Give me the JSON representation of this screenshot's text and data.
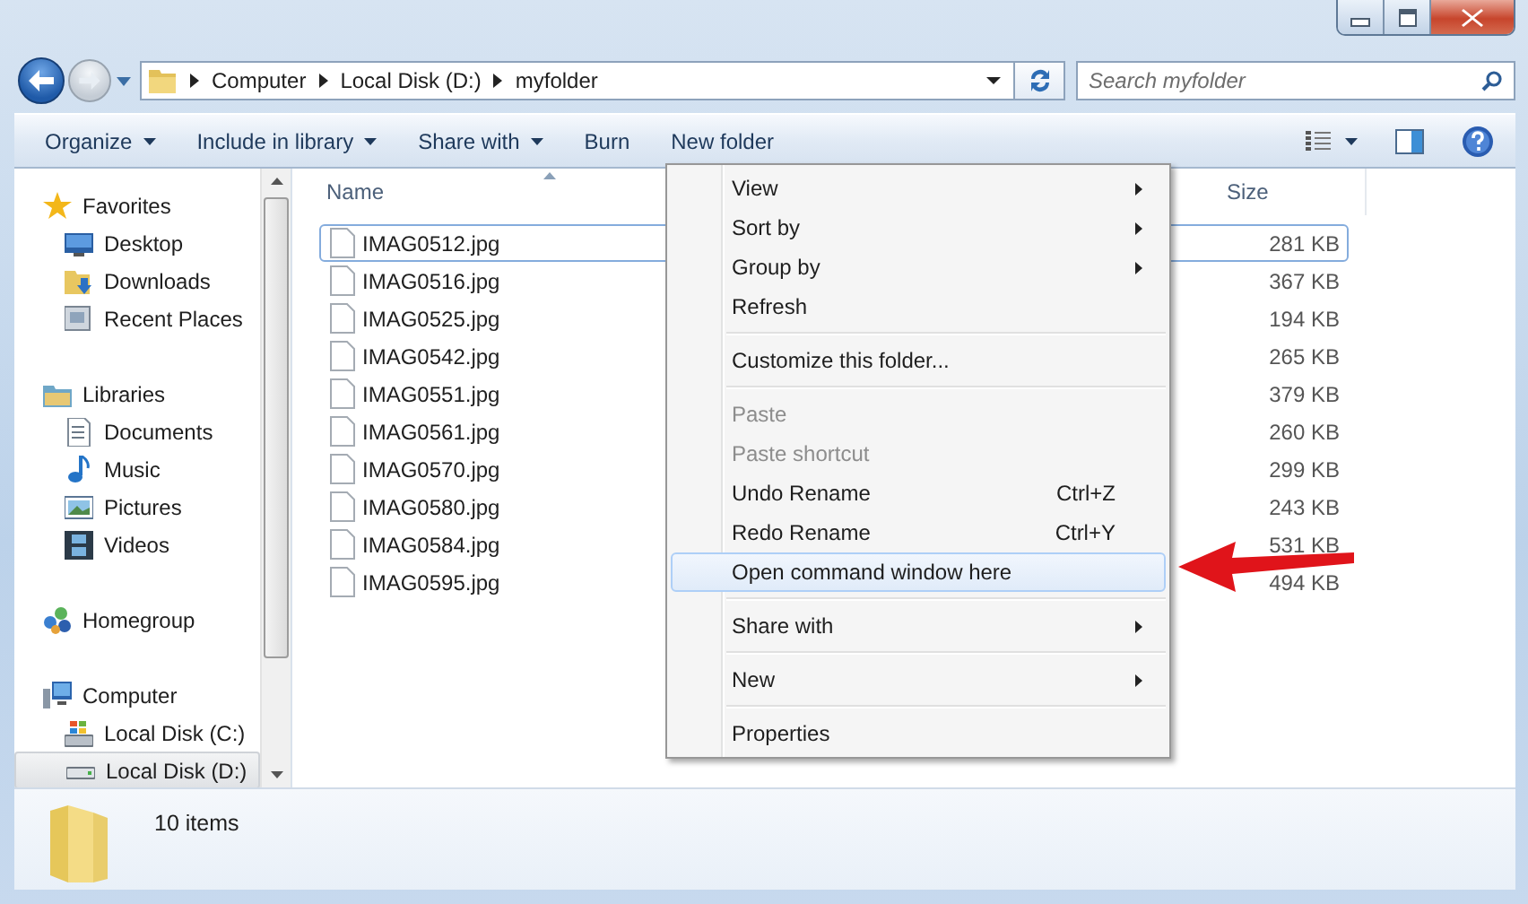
{
  "address_bar": {
    "path": [
      "Computer",
      "Local Disk (D:)",
      "myfolder"
    ]
  },
  "search": {
    "placeholder": "Search myfolder"
  },
  "toolbar": [
    {
      "label": "Organize",
      "dropdown": true
    },
    {
      "label": "Include in library",
      "dropdown": true
    },
    {
      "label": "Share with",
      "dropdown": true
    },
    {
      "label": "Burn",
      "dropdown": false
    },
    {
      "label": "New folder",
      "dropdown": false
    }
  ],
  "nav": [
    {
      "label": "Favorites",
      "kind": "favorites",
      "selected": false,
      "children": [
        {
          "label": "Desktop",
          "kind": "desktop",
          "selected": false
        },
        {
          "label": "Downloads",
          "kind": "downloads",
          "selected": false
        },
        {
          "label": "Recent Places",
          "kind": "recent",
          "selected": false
        }
      ]
    },
    {
      "label": "Libraries",
      "kind": "libraries",
      "selected": false,
      "children": [
        {
          "label": "Documents",
          "kind": "documents",
          "selected": false
        },
        {
          "label": "Music",
          "kind": "music",
          "selected": false
        },
        {
          "label": "Pictures",
          "kind": "pictures",
          "selected": false
        },
        {
          "label": "Videos",
          "kind": "videos",
          "selected": false
        }
      ]
    },
    {
      "label": "Homegroup",
      "kind": "homegroup",
      "selected": false
    },
    {
      "label": "Computer",
      "kind": "computer",
      "selected": false,
      "children": [
        {
          "label": "Local Disk (C:)",
          "kind": "system_drive",
          "selected": false
        },
        {
          "label": "Local Disk (D:)",
          "kind": "drive",
          "selected": true
        }
      ]
    }
  ],
  "columns": [
    {
      "label": "Name",
      "sorted": true
    },
    {
      "label": "Size",
      "sorted": false
    }
  ],
  "files": [
    {
      "name": "IMAG0512.jpg",
      "size": "281 KB",
      "selected": true
    },
    {
      "name": "IMAG0516.jpg",
      "size": "367 KB",
      "selected": false
    },
    {
      "name": "IMAG0525.jpg",
      "size": "194 KB",
      "selected": false
    },
    {
      "name": "IMAG0542.jpg",
      "size": "265 KB",
      "selected": false
    },
    {
      "name": "IMAG0551.jpg",
      "size": "379 KB",
      "selected": false
    },
    {
      "name": "IMAG0561.jpg",
      "size": "260 KB",
      "selected": false
    },
    {
      "name": "IMAG0570.jpg",
      "size": "299 KB",
      "selected": false
    },
    {
      "name": "IMAG0580.jpg",
      "size": "243 KB",
      "selected": false
    },
    {
      "name": "IMAG0584.jpg",
      "size": "531 KB",
      "selected": false
    },
    {
      "name": "IMAG0595.jpg",
      "size": "494 KB",
      "selected": false
    }
  ],
  "context_menu": {
    "groups": [
      [
        {
          "label": "View",
          "submenu": true,
          "disabled": false,
          "selected": false
        },
        {
          "label": "Sort by",
          "submenu": true,
          "disabled": false,
          "selected": false
        },
        {
          "label": "Group by",
          "submenu": true,
          "disabled": false,
          "selected": false
        },
        {
          "label": "Refresh",
          "submenu": false,
          "disabled": false,
          "selected": false
        }
      ],
      [
        {
          "label": "Customize this folder...",
          "submenu": false,
          "disabled": false,
          "selected": false
        }
      ],
      [
        {
          "label": "Paste",
          "submenu": false,
          "disabled": true,
          "selected": false
        },
        {
          "label": "Paste shortcut",
          "submenu": false,
          "disabled": true,
          "selected": false
        },
        {
          "label": "Undo Rename",
          "shortcut": "Ctrl+Z",
          "submenu": false,
          "disabled": false,
          "selected": false
        },
        {
          "label": "Redo Rename",
          "shortcut": "Ctrl+Y",
          "submenu": false,
          "disabled": false,
          "selected": false
        },
        {
          "label": "Open command window here",
          "submenu": false,
          "disabled": false,
          "selected": true
        }
      ],
      [
        {
          "label": "Share with",
          "submenu": true,
          "disabled": false,
          "selected": false
        }
      ],
      [
        {
          "label": "New",
          "submenu": true,
          "disabled": false,
          "selected": false
        }
      ],
      [
        {
          "label": "Properties",
          "submenu": false,
          "disabled": false,
          "selected": false
        }
      ]
    ]
  },
  "status_bar": {
    "text": "10 items"
  }
}
